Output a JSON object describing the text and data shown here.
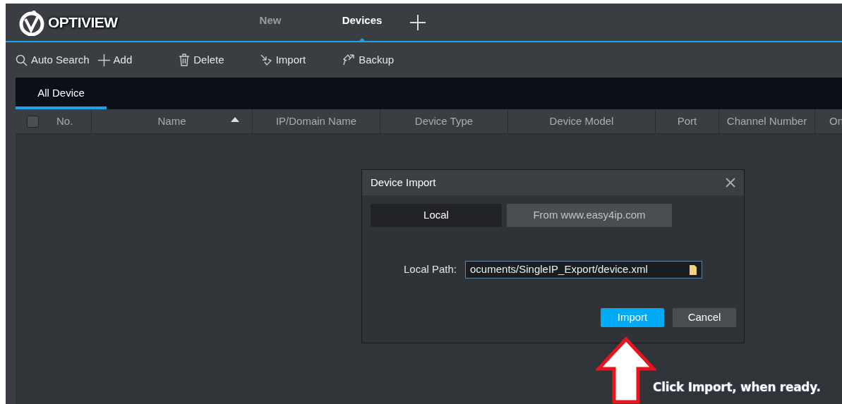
{
  "logo": {
    "text": "OPTIVIEW"
  },
  "tabs": [
    {
      "label": "New",
      "selected": false
    },
    {
      "label": "Devices",
      "selected": true
    }
  ],
  "toolbar": [
    {
      "label": "Auto Search",
      "kind": "search"
    },
    {
      "label": "Add",
      "kind": "add"
    },
    {
      "label": "Delete",
      "kind": "delete"
    },
    {
      "label": "Import",
      "kind": "import"
    },
    {
      "label": "Backup",
      "kind": "backup"
    }
  ],
  "subtabs": [
    {
      "label": "All Device",
      "selected": true
    }
  ],
  "table": {
    "select_all_checked": false,
    "columns": [
      {
        "label": "No.",
        "sorted": false
      },
      {
        "label": "Name",
        "sorted": true
      },
      {
        "label": "IP/Domain Name",
        "sorted": false
      },
      {
        "label": "Device Type",
        "sorted": false
      },
      {
        "label": "Device Model",
        "sorted": false
      },
      {
        "label": "Port",
        "sorted": false
      },
      {
        "label": "Channel Number",
        "sorted": false
      },
      {
        "label": "On",
        "sorted": false
      }
    ]
  },
  "dialog": {
    "title": "Device Import",
    "tabs": [
      {
        "label": "Local",
        "selected": true
      },
      {
        "label": "From www.easy4ip.com",
        "selected": false
      }
    ],
    "field": {
      "label": "Local Path:",
      "value": "ocuments/SingleIP_Export/device.xml"
    },
    "buttons": [
      {
        "label": "Import",
        "kind": "primary"
      },
      {
        "label": "Cancel",
        "kind": "secondary"
      }
    ]
  },
  "annotation": {
    "text": "Click Import, when ready."
  }
}
